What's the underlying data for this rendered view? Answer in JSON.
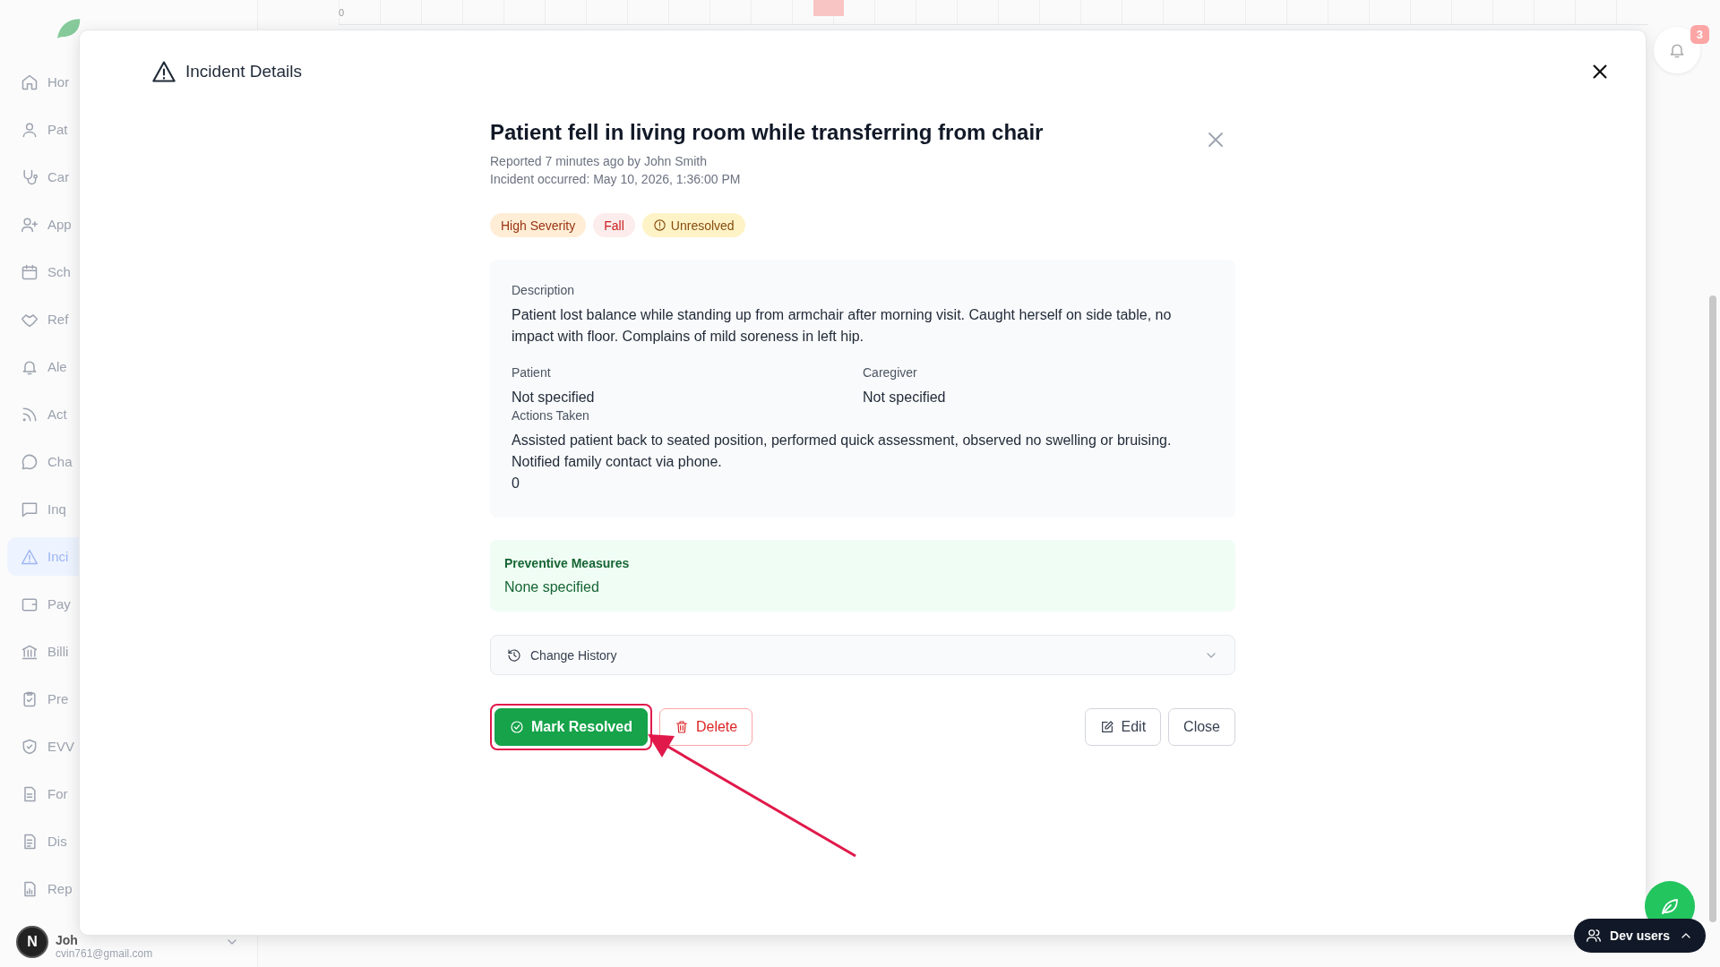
{
  "sidebar": {
    "items": [
      {
        "label": "Hor",
        "selected": false
      },
      {
        "label": "Pat",
        "selected": false
      },
      {
        "label": "Car",
        "selected": false
      },
      {
        "label": "App",
        "selected": false
      },
      {
        "label": "Sch",
        "selected": false
      },
      {
        "label": "Ref",
        "selected": false
      },
      {
        "label": "Ale",
        "selected": false
      },
      {
        "label": "Act",
        "selected": false
      },
      {
        "label": "Cha",
        "selected": false
      },
      {
        "label": "Inq",
        "selected": false
      },
      {
        "label": "Inci",
        "selected": true
      },
      {
        "label": "Pay",
        "selected": false
      },
      {
        "label": "Billi",
        "selected": false
      },
      {
        "label": "Pre",
        "selected": false
      },
      {
        "label": "EVV",
        "selected": false
      },
      {
        "label": "For",
        "selected": false
      },
      {
        "label": "Dis",
        "selected": false
      },
      {
        "label": "Rep",
        "selected": false
      }
    ],
    "user": {
      "avatar": "N",
      "name": "Joh",
      "email": "cvin761@gmail.com"
    }
  },
  "chart_strip": {
    "tick": "0"
  },
  "notifications": {
    "count": "3"
  },
  "dev_users": {
    "label": "Dev users"
  },
  "modal": {
    "title": "Incident Details",
    "incident": {
      "title": "Patient fell in living room while transferring from chair",
      "reported": "Reported 7 minutes ago by John Smith",
      "occurred": "Incident occurred: May 10, 2026, 1:36:00 PM",
      "tags": [
        {
          "label": "High Severity",
          "kind": "severity"
        },
        {
          "label": "Fall",
          "kind": "type"
        },
        {
          "label": "Unresolved",
          "kind": "status"
        }
      ],
      "description": {
        "label": "Description",
        "value": "Patient lost balance while standing up from armchair after morning visit. Caught herself on side table, no impact with floor. Complains of mild soreness in left hip."
      },
      "patient": {
        "label": "Patient",
        "value": "Not specified"
      },
      "caregiver": {
        "label": "Caregiver",
        "value": "Not specified"
      },
      "actions_taken": {
        "label": "Actions Taken",
        "value": "Assisted patient back to seated position, performed quick assessment, observed no swelling or bruising. Notified family contact via phone.",
        "extra": "0"
      },
      "preventive": {
        "label": "Preventive Measures",
        "value": "None specified"
      },
      "history": {
        "label": "Change History",
        "expanded": false
      },
      "buttons": [
        {
          "label": "Mark Resolved",
          "kind": "resolve",
          "highlighted": true
        },
        {
          "label": "Delete",
          "kind": "delete",
          "highlighted": false
        },
        {
          "label": "Edit",
          "kind": "edit",
          "highlighted": false
        },
        {
          "label": "Close",
          "kind": "close",
          "highlighted": false
        }
      ]
    }
  }
}
